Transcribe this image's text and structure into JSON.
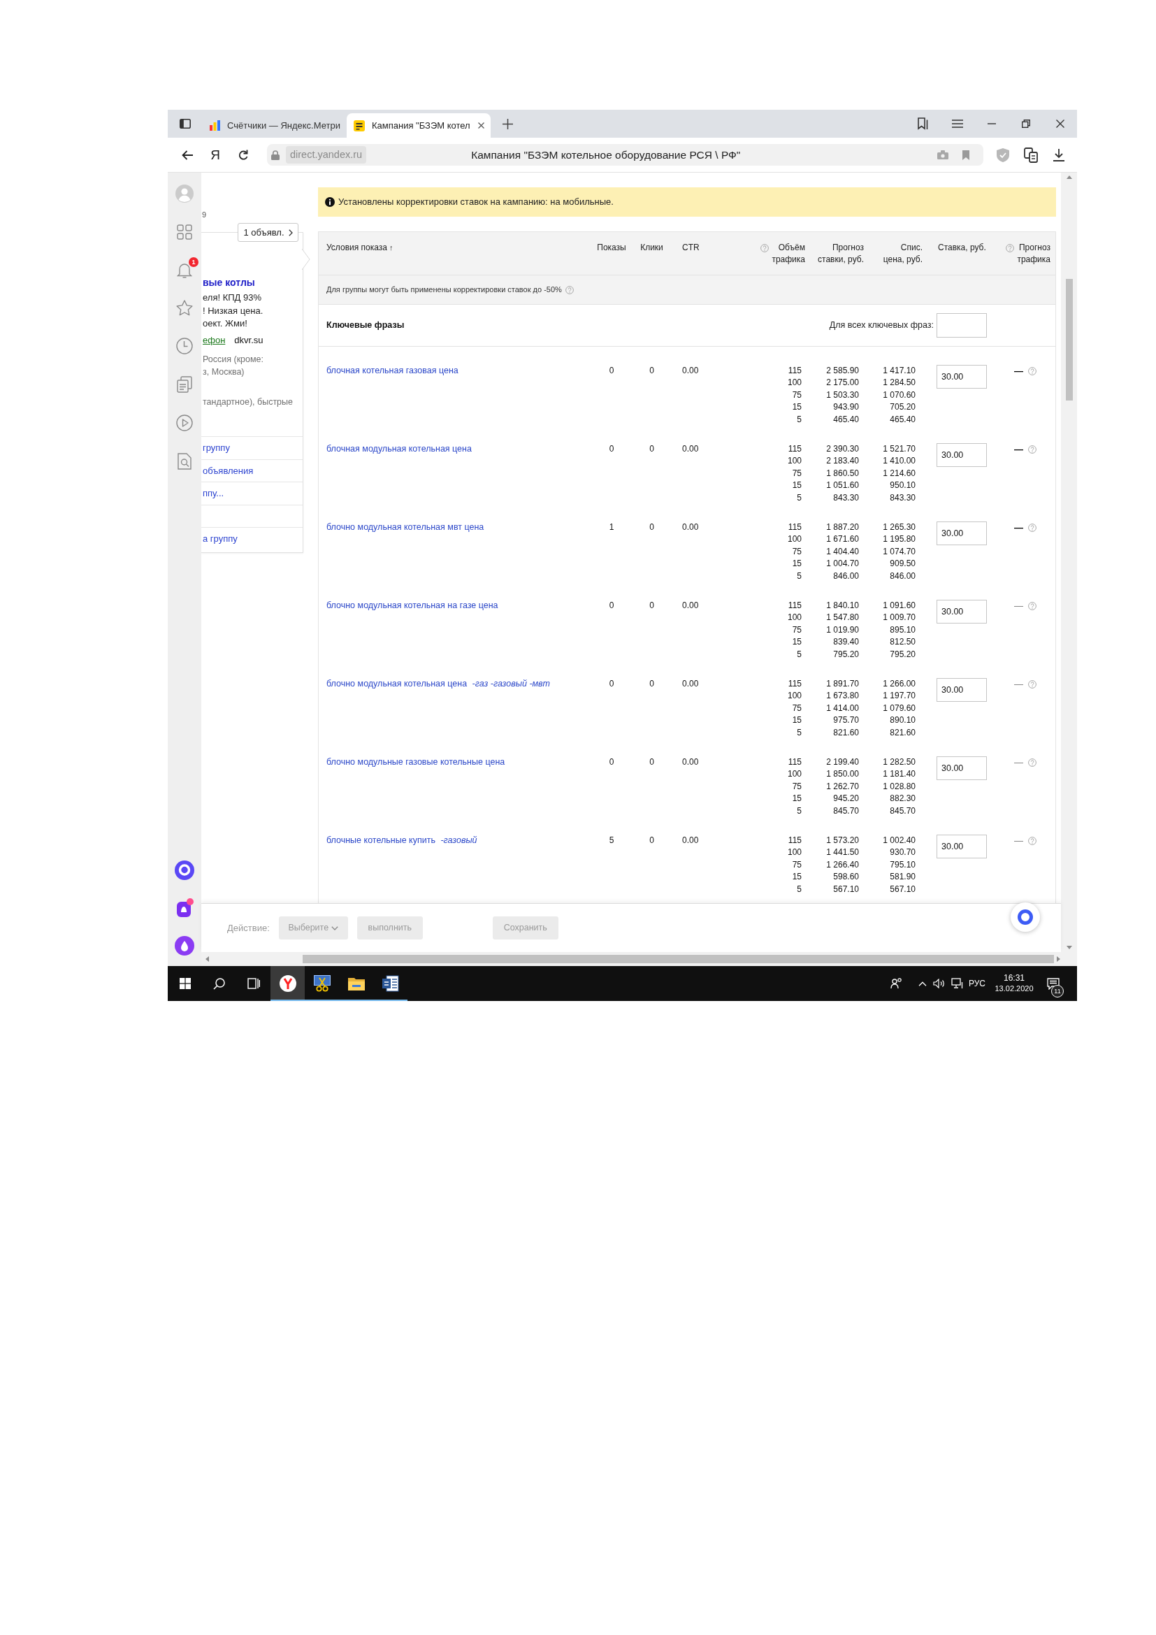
{
  "browser": {
    "tabs": [
      {
        "kind": "chart",
        "title": "Счётчики — Яндекс.Метри",
        "selected": false
      },
      {
        "kind": "tile",
        "title": "Кампания \"БЗЭМ котел",
        "selected": true
      }
    ],
    "home_key": "Я",
    "address": "direct.yandex.ru",
    "page_title": "Кампания \"БЗЭМ котельное оборудование РСЯ \\ РФ\""
  },
  "sidebar": {
    "notification_count": "1"
  },
  "ad_panel": {
    "fragment": "9",
    "ads_button": "1 объявл.",
    "headline": "вые котлы",
    "text_lines": [
      "еля! КПД 93%",
      "! Низкая цена.",
      "оект. Жми!"
    ],
    "links": [
      {
        "text": "ефон",
        "underlined": true
      },
      {
        "text": "dkvr.su",
        "underlined": false
      }
    ],
    "region_lines": [
      "Россия (кроме:",
      "з, Москва)"
    ],
    "extras": "тандартное), быстрые",
    "actions": [
      {
        "kind": "link",
        "label": "группу"
      },
      {
        "kind": "link",
        "label": "объявления"
      },
      {
        "kind": "link",
        "label": "ппу..."
      },
      {
        "kind": "blank"
      },
      {
        "kind": "link",
        "label": "а группу"
      }
    ]
  },
  "notice": {
    "text": "Установлены корректировки ставок на кампанию: на мобильные."
  },
  "table": {
    "columns": [
      {
        "lines": [
          "Условия показа"
        ],
        "sort": "↑",
        "help": false
      },
      {
        "lines": [
          "Показы"
        ],
        "help": false
      },
      {
        "lines": [
          "Клики"
        ],
        "help": false
      },
      {
        "lines": [
          "CTR"
        ],
        "help": false
      },
      {
        "lines": [
          "Объём",
          "трафика"
        ],
        "help": true
      },
      {
        "lines": [
          "Прогноз",
          "ставки, руб."
        ],
        "help": false
      },
      {
        "lines": [
          "Спис.",
          "цена, руб."
        ],
        "help": false
      },
      {
        "lines": [
          "Ставка, руб."
        ],
        "help": false
      },
      {
        "lines": [
          "Прогноз",
          "трафика"
        ],
        "help": true
      }
    ],
    "group_note": {
      "text": "Для группы могут быть применены корректировки ставок до -50%",
      "help": true
    },
    "keywords": {
      "title": "Ключевые фразы",
      "all_label": "Для всех ключевых фраз:"
    },
    "rows": [
      {
        "phrase": "блочная котельная газовая цена",
        "impressions": "0",
        "clicks": "0",
        "ctr": "0.00",
        "forecast": [
          {
            "traffic": "115",
            "bid": "2 585.90",
            "charge": "1 417.10"
          },
          {
            "traffic": "100",
            "bid": "2 175.00",
            "charge": "1 284.50"
          },
          {
            "traffic": "75",
            "bid": "1 503.30",
            "charge": "1 070.60"
          },
          {
            "traffic": "15",
            "bid": "943.90",
            "charge": "705.20"
          },
          {
            "traffic": "5",
            "bid": "465.40",
            "charge": "465.40"
          }
        ],
        "bid": "30.00",
        "traffic_forecast": "—",
        "dash_bold": true,
        "help": true
      },
      {
        "phrase": "блочная модульная котельная цена",
        "impressions": "0",
        "clicks": "0",
        "ctr": "0.00",
        "forecast": [
          {
            "traffic": "115",
            "bid": "2 390.30",
            "charge": "1 521.70"
          },
          {
            "traffic": "100",
            "bid": "2 183.40",
            "charge": "1 410.00"
          },
          {
            "traffic": "75",
            "bid": "1 860.50",
            "charge": "1 214.60"
          },
          {
            "traffic": "15",
            "bid": "1 051.60",
            "charge": "950.10"
          },
          {
            "traffic": "5",
            "bid": "843.30",
            "charge": "843.30"
          }
        ],
        "bid": "30.00",
        "traffic_forecast": "—",
        "dash_bold": true,
        "help": true
      },
      {
        "phrase": "блочно модульная котельная мвт цена",
        "impressions": "1",
        "clicks": "0",
        "ctr": "0.00",
        "forecast": [
          {
            "traffic": "115",
            "bid": "1 887.20",
            "charge": "1 265.30"
          },
          {
            "traffic": "100",
            "bid": "1 671.60",
            "charge": "1 195.80"
          },
          {
            "traffic": "75",
            "bid": "1 404.40",
            "charge": "1 074.70"
          },
          {
            "traffic": "15",
            "bid": "1 004.70",
            "charge": "909.50"
          },
          {
            "traffic": "5",
            "bid": "846.00",
            "charge": "846.00"
          }
        ],
        "bid": "30.00",
        "traffic_forecast": "—",
        "dash_bold": true,
        "help": true
      },
      {
        "phrase": "блочно модульная котельная на газе цена",
        "impressions": "0",
        "clicks": "0",
        "ctr": "0.00",
        "forecast": [
          {
            "traffic": "115",
            "bid": "1 840.10",
            "charge": "1 091.60"
          },
          {
            "traffic": "100",
            "bid": "1 547.80",
            "charge": "1 009.70"
          },
          {
            "traffic": "75",
            "bid": "1 019.90",
            "charge": "895.10"
          },
          {
            "traffic": "15",
            "bid": "839.40",
            "charge": "812.50"
          },
          {
            "traffic": "5",
            "bid": "795.20",
            "charge": "795.20"
          }
        ],
        "bid": "30.00",
        "traffic_forecast": "—",
        "dash_bold": false,
        "help": true
      },
      {
        "phrase": "блочно модульная котельная цена *-газ -газовый -мвт*",
        "impressions": "0",
        "clicks": "0",
        "ctr": "0.00",
        "forecast": [
          {
            "traffic": "115",
            "bid": "1 891.70",
            "charge": "1 266.00"
          },
          {
            "traffic": "100",
            "bid": "1 673.80",
            "charge": "1 197.70"
          },
          {
            "traffic": "75",
            "bid": "1 414.00",
            "charge": "1 079.60"
          },
          {
            "traffic": "15",
            "bid": "975.70",
            "charge": "890.10"
          },
          {
            "traffic": "5",
            "bid": "821.60",
            "charge": "821.60"
          }
        ],
        "bid": "30.00",
        "traffic_forecast": "—",
        "dash_bold": false,
        "help": true
      },
      {
        "phrase": "блочно модульные газовые котельные цена",
        "impressions": "0",
        "clicks": "0",
        "ctr": "0.00",
        "forecast": [
          {
            "traffic": "115",
            "bid": "2 199.40",
            "charge": "1 282.50"
          },
          {
            "traffic": "100",
            "bid": "1 850.00",
            "charge": "1 181.40"
          },
          {
            "traffic": "75",
            "bid": "1 262.70",
            "charge": "1 028.80"
          },
          {
            "traffic": "15",
            "bid": "945.20",
            "charge": "882.30"
          },
          {
            "traffic": "5",
            "bid": "845.70",
            "charge": "845.70"
          }
        ],
        "bid": "30.00",
        "traffic_forecast": "—",
        "dash_bold": false,
        "help": true
      },
      {
        "phrase": "блочные котельные купить *-газовый*",
        "impressions": "5",
        "clicks": "0",
        "ctr": "0.00",
        "forecast": [
          {
            "traffic": "115",
            "bid": "1 573.20",
            "charge": "1 002.40"
          },
          {
            "traffic": "100",
            "bid": "1 441.50",
            "charge": "930.70"
          },
          {
            "traffic": "75",
            "bid": "1 266.40",
            "charge": "795.10"
          },
          {
            "traffic": "15",
            "bid": "598.60",
            "charge": "581.90"
          },
          {
            "traffic": "5",
            "bid": "567.10",
            "charge": "567.10"
          }
        ],
        "bid": "30.00",
        "traffic_forecast": "—",
        "dash_bold": false,
        "help": true
      }
    ]
  },
  "footer": {
    "label": "Действие:",
    "buttons": [
      {
        "kind": "select",
        "label": "Выберите",
        "disabled": true
      },
      {
        "kind": "action",
        "label": "выполнить",
        "disabled": true
      },
      {
        "kind": "save",
        "label": "Сохранить",
        "disabled": true
      }
    ]
  },
  "taskbar": {
    "apps": [
      {
        "kind": "browser",
        "selected": true
      },
      {
        "kind": "snipping",
        "selected": false
      },
      {
        "kind": "folder",
        "selected": false
      },
      {
        "kind": "document",
        "selected": false
      }
    ],
    "language": "РУС",
    "time": "16:31",
    "date": "13.02.2020",
    "notification_count": "11"
  }
}
